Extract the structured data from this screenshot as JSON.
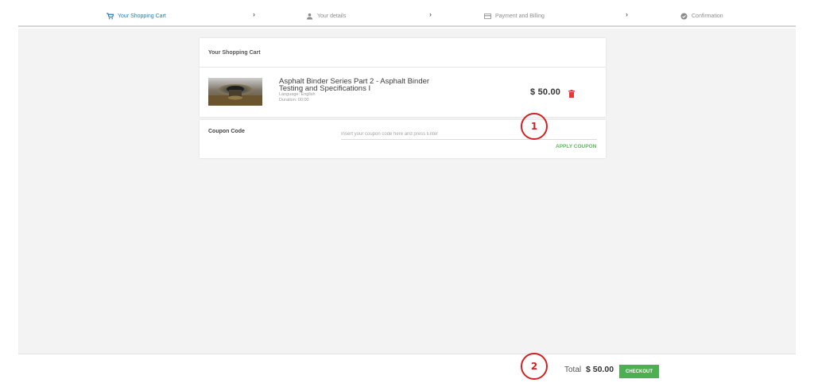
{
  "stepper": {
    "steps": [
      {
        "label": "Your Shopping Cart",
        "icon": "cart-icon",
        "active": true
      },
      {
        "label": "Your details",
        "icon": "person-icon",
        "active": false
      },
      {
        "label": "Payment and Billing",
        "icon": "credit-card-icon",
        "active": false
      },
      {
        "label": "Confirmation",
        "icon": "check-circle-icon",
        "active": false
      }
    ],
    "separator": "›"
  },
  "cart": {
    "title": "Your Shopping Cart",
    "item": {
      "title": "Asphalt Binder Series Part 2 - Asphalt Binder Testing and Specifications I",
      "language": "Language: English",
      "duration": "Duration: 00:00",
      "price": "$ 50.00"
    }
  },
  "coupon": {
    "label": "Coupon Code",
    "placeholder": "Insert your coupon code here and press Enter",
    "apply_label": "APPLY COUPON"
  },
  "annotations": [
    "1",
    "2"
  ],
  "footer": {
    "total_label": "Total",
    "total_value": "$ 50.00",
    "checkout_label": "CHECKOUT"
  },
  "colors": {
    "accent": "#1e7dc2",
    "success": "#4caf50",
    "delete": "#e53935",
    "annotation": "#d42020"
  }
}
